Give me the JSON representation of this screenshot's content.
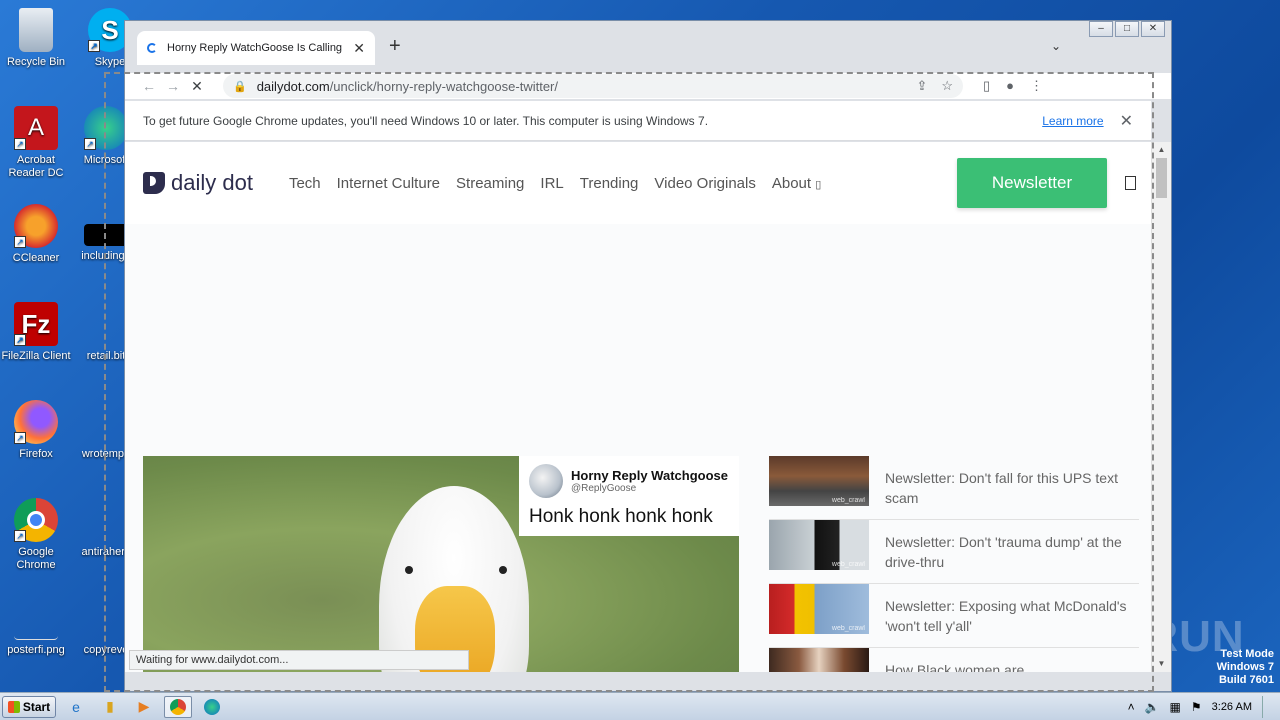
{
  "desktop": {
    "icons": [
      {
        "label": "Recycle Bin",
        "icon": "recycle-bin-icon"
      },
      {
        "label": "Skype",
        "icon": "skype-icon"
      },
      {
        "label": "Acrobat Reader DC",
        "icon": "acrobat-icon"
      },
      {
        "label": "Microsoft",
        "icon": "edge-icon"
      },
      {
        "label": "CCleaner",
        "icon": "ccleaner-icon"
      },
      {
        "label": "includingo",
        "icon": "file-icon"
      },
      {
        "label": "FileZilla Client",
        "icon": "filezilla-icon"
      },
      {
        "label": "retail.bit",
        "icon": "file-icon"
      },
      {
        "label": "Firefox",
        "icon": "firefox-icon"
      },
      {
        "label": "wrotempa",
        "icon": "file-icon"
      },
      {
        "label": "Google Chrome",
        "icon": "chrome-icon"
      },
      {
        "label": "antirahers",
        "icon": "file-icon"
      },
      {
        "label": "posterfi.png",
        "icon": "image-file-icon"
      },
      {
        "label": "copyreve",
        "icon": "file-icon"
      }
    ]
  },
  "browser": {
    "tab_title": "Horny Reply WatchGoose Is Calling",
    "url_host": "dailydot.com",
    "url_path": "/unclick/horny-reply-watchgoose-twitter/",
    "infobar_text": "To get future Google Chrome updates, you'll need Windows 10 or later. This computer is using Windows 7.",
    "infobar_link": "Learn more",
    "status_text": "Waiting for www.dailydot.com..."
  },
  "site": {
    "logo_text": "daily dot",
    "nav": [
      "Tech",
      "Internet Culture",
      "Streaming",
      "IRL",
      "Trending",
      "Video Originals",
      "About"
    ],
    "newsletter_label": "Newsletter",
    "hero_tweet": {
      "name": "Horny Reply Watchgoose",
      "handle": "@ReplyGoose",
      "text": "Honk honk honk honk"
    },
    "sidebar": [
      {
        "title": "Newsletter: Don't fall for this UPS text scam",
        "watermark": "web_crawl"
      },
      {
        "title": "Newsletter: Don't 'trauma dump' at the drive-thru",
        "watermark": "web_crawl"
      },
      {
        "title": "Newsletter: Exposing what McDonald's 'won't tell y'all'",
        "watermark": "web_crawl"
      },
      {
        "title": "How Black women are",
        "watermark": ""
      }
    ]
  },
  "watermark": {
    "anyrun": "ANY RUN",
    "test_mode": "Test Mode",
    "os": "Windows 7",
    "build": "Build 7601"
  },
  "taskbar": {
    "start_label": "Start",
    "clock": "3:26 AM"
  }
}
